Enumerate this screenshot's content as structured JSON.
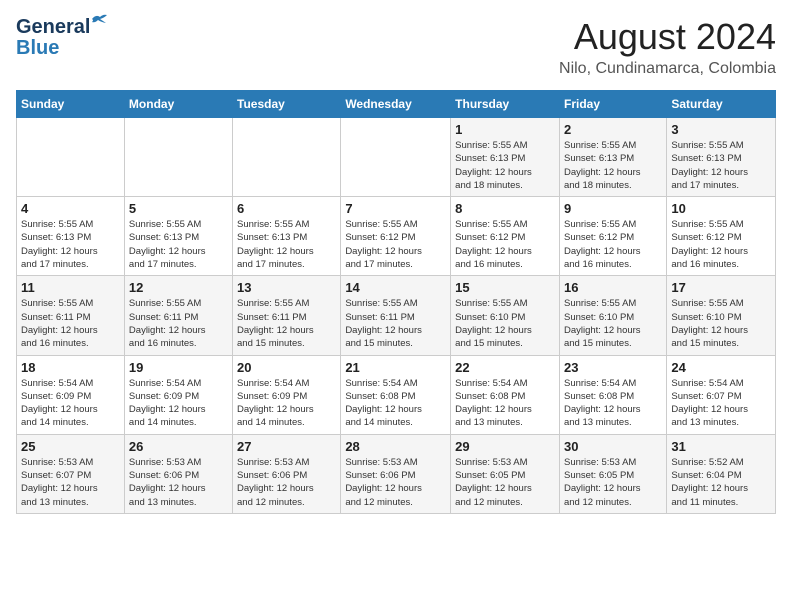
{
  "logo": {
    "line1": "General",
    "line2": "Blue"
  },
  "title": "August 2024",
  "location": "Nilo, Cundinamarca, Colombia",
  "weekdays": [
    "Sunday",
    "Monday",
    "Tuesday",
    "Wednesday",
    "Thursday",
    "Friday",
    "Saturday"
  ],
  "weeks": [
    [
      {
        "day": "",
        "info": ""
      },
      {
        "day": "",
        "info": ""
      },
      {
        "day": "",
        "info": ""
      },
      {
        "day": "",
        "info": ""
      },
      {
        "day": "1",
        "info": "Sunrise: 5:55 AM\nSunset: 6:13 PM\nDaylight: 12 hours\nand 18 minutes."
      },
      {
        "day": "2",
        "info": "Sunrise: 5:55 AM\nSunset: 6:13 PM\nDaylight: 12 hours\nand 18 minutes."
      },
      {
        "day": "3",
        "info": "Sunrise: 5:55 AM\nSunset: 6:13 PM\nDaylight: 12 hours\nand 17 minutes."
      }
    ],
    [
      {
        "day": "4",
        "info": "Sunrise: 5:55 AM\nSunset: 6:13 PM\nDaylight: 12 hours\nand 17 minutes."
      },
      {
        "day": "5",
        "info": "Sunrise: 5:55 AM\nSunset: 6:13 PM\nDaylight: 12 hours\nand 17 minutes."
      },
      {
        "day": "6",
        "info": "Sunrise: 5:55 AM\nSunset: 6:13 PM\nDaylight: 12 hours\nand 17 minutes."
      },
      {
        "day": "7",
        "info": "Sunrise: 5:55 AM\nSunset: 6:12 PM\nDaylight: 12 hours\nand 17 minutes."
      },
      {
        "day": "8",
        "info": "Sunrise: 5:55 AM\nSunset: 6:12 PM\nDaylight: 12 hours\nand 16 minutes."
      },
      {
        "day": "9",
        "info": "Sunrise: 5:55 AM\nSunset: 6:12 PM\nDaylight: 12 hours\nand 16 minutes."
      },
      {
        "day": "10",
        "info": "Sunrise: 5:55 AM\nSunset: 6:12 PM\nDaylight: 12 hours\nand 16 minutes."
      }
    ],
    [
      {
        "day": "11",
        "info": "Sunrise: 5:55 AM\nSunset: 6:11 PM\nDaylight: 12 hours\nand 16 minutes."
      },
      {
        "day": "12",
        "info": "Sunrise: 5:55 AM\nSunset: 6:11 PM\nDaylight: 12 hours\nand 16 minutes."
      },
      {
        "day": "13",
        "info": "Sunrise: 5:55 AM\nSunset: 6:11 PM\nDaylight: 12 hours\nand 15 minutes."
      },
      {
        "day": "14",
        "info": "Sunrise: 5:55 AM\nSunset: 6:11 PM\nDaylight: 12 hours\nand 15 minutes."
      },
      {
        "day": "15",
        "info": "Sunrise: 5:55 AM\nSunset: 6:10 PM\nDaylight: 12 hours\nand 15 minutes."
      },
      {
        "day": "16",
        "info": "Sunrise: 5:55 AM\nSunset: 6:10 PM\nDaylight: 12 hours\nand 15 minutes."
      },
      {
        "day": "17",
        "info": "Sunrise: 5:55 AM\nSunset: 6:10 PM\nDaylight: 12 hours\nand 15 minutes."
      }
    ],
    [
      {
        "day": "18",
        "info": "Sunrise: 5:54 AM\nSunset: 6:09 PM\nDaylight: 12 hours\nand 14 minutes."
      },
      {
        "day": "19",
        "info": "Sunrise: 5:54 AM\nSunset: 6:09 PM\nDaylight: 12 hours\nand 14 minutes."
      },
      {
        "day": "20",
        "info": "Sunrise: 5:54 AM\nSunset: 6:09 PM\nDaylight: 12 hours\nand 14 minutes."
      },
      {
        "day": "21",
        "info": "Sunrise: 5:54 AM\nSunset: 6:08 PM\nDaylight: 12 hours\nand 14 minutes."
      },
      {
        "day": "22",
        "info": "Sunrise: 5:54 AM\nSunset: 6:08 PM\nDaylight: 12 hours\nand 13 minutes."
      },
      {
        "day": "23",
        "info": "Sunrise: 5:54 AM\nSunset: 6:08 PM\nDaylight: 12 hours\nand 13 minutes."
      },
      {
        "day": "24",
        "info": "Sunrise: 5:54 AM\nSunset: 6:07 PM\nDaylight: 12 hours\nand 13 minutes."
      }
    ],
    [
      {
        "day": "25",
        "info": "Sunrise: 5:53 AM\nSunset: 6:07 PM\nDaylight: 12 hours\nand 13 minutes."
      },
      {
        "day": "26",
        "info": "Sunrise: 5:53 AM\nSunset: 6:06 PM\nDaylight: 12 hours\nand 13 minutes."
      },
      {
        "day": "27",
        "info": "Sunrise: 5:53 AM\nSunset: 6:06 PM\nDaylight: 12 hours\nand 12 minutes."
      },
      {
        "day": "28",
        "info": "Sunrise: 5:53 AM\nSunset: 6:06 PM\nDaylight: 12 hours\nand 12 minutes."
      },
      {
        "day": "29",
        "info": "Sunrise: 5:53 AM\nSunset: 6:05 PM\nDaylight: 12 hours\nand 12 minutes."
      },
      {
        "day": "30",
        "info": "Sunrise: 5:53 AM\nSunset: 6:05 PM\nDaylight: 12 hours\nand 12 minutes."
      },
      {
        "day": "31",
        "info": "Sunrise: 5:52 AM\nSunset: 6:04 PM\nDaylight: 12 hours\nand 11 minutes."
      }
    ]
  ]
}
